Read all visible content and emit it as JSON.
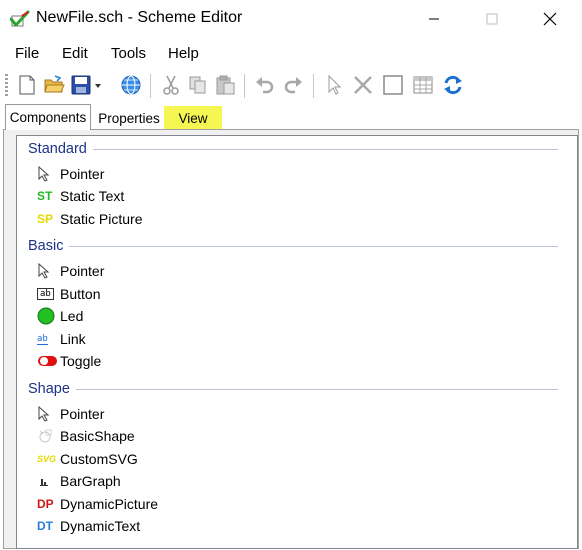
{
  "window": {
    "title": "NewFile.sch - Scheme Editor"
  },
  "menu": {
    "items": [
      "File",
      "Edit",
      "Tools",
      "Help"
    ]
  },
  "tabs": {
    "components": "Components",
    "properties": "Properties",
    "view": "View"
  },
  "groups": [
    {
      "title": "Standard",
      "items": [
        {
          "label": "Pointer",
          "icon": "pointer-icon"
        },
        {
          "label": "Static Text",
          "icon": "st-icon",
          "badge": "ST",
          "color": "#22b822"
        },
        {
          "label": "Static Picture",
          "icon": "sp-icon",
          "badge": "SP",
          "color": "#e6d800"
        }
      ]
    },
    {
      "title": "Basic",
      "items": [
        {
          "label": "Pointer",
          "icon": "pointer-icon"
        },
        {
          "label": "Button",
          "icon": "button-icon",
          "badge": "ab"
        },
        {
          "label": "Led",
          "icon": "led-icon",
          "color": "#22c022"
        },
        {
          "label": "Link",
          "icon": "link-icon",
          "badge": "ab",
          "color": "#1e6fd9"
        },
        {
          "label": "Toggle",
          "icon": "toggle-icon",
          "color": "#e01010"
        }
      ]
    },
    {
      "title": "Shape",
      "items": [
        {
          "label": "Pointer",
          "icon": "pointer-icon"
        },
        {
          "label": "BasicShape",
          "icon": "basic-shape-icon"
        },
        {
          "label": "CustomSVG",
          "icon": "svg-icon",
          "badge": "SVG",
          "color": "#e6d800"
        },
        {
          "label": "BarGraph",
          "icon": "bar-graph-icon"
        },
        {
          "label": "DynamicPicture",
          "icon": "dp-icon",
          "badge": "DP",
          "color": "#d01818"
        },
        {
          "label": "DynamicText",
          "icon": "dt-icon",
          "badge": "DT",
          "color": "#2a7ed8"
        }
      ]
    }
  ],
  "colors": {
    "group_title": "#1e3287",
    "tab_highlight": "#f6f653",
    "accent_blue": "#1e6fd9"
  }
}
